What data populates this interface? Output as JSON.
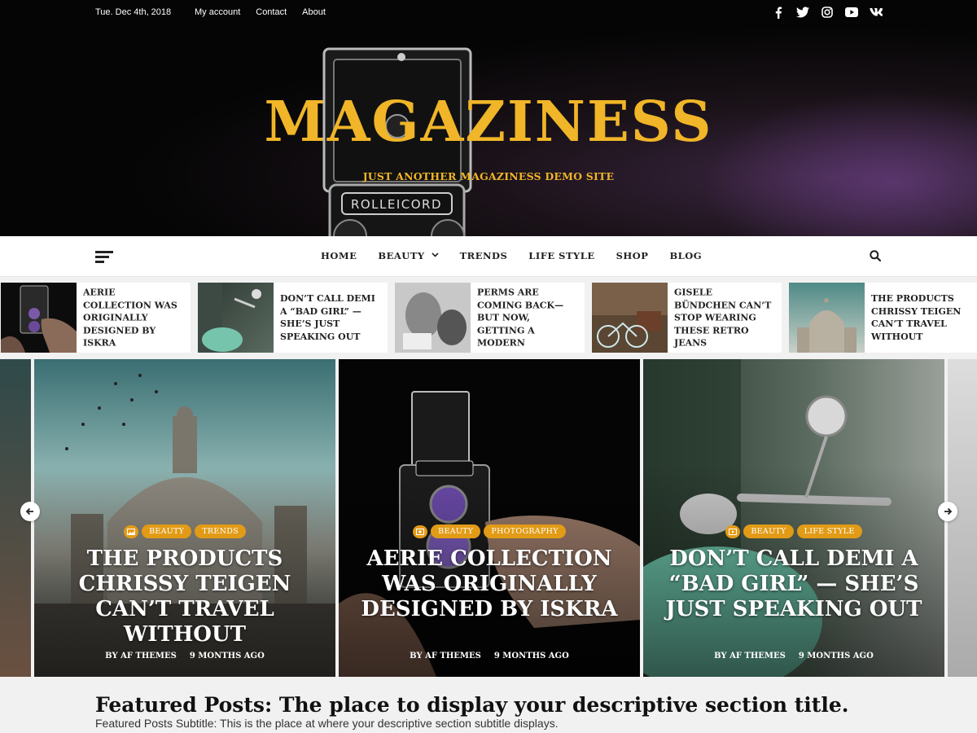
{
  "topbar": {
    "date": "Tue. Dec 4th, 2018",
    "links": [
      "My account",
      "Contact",
      "About"
    ],
    "socials": [
      "facebook-icon",
      "twitter-icon",
      "instagram-icon",
      "youtube-icon",
      "vk-icon"
    ]
  },
  "header": {
    "site_title": "MAGAZINESS",
    "tagline": "JUST ANOTHER MAGAZINESS DEMO SITE",
    "camera_label": "ROLLEICORD",
    "accent_color": "#f0b528"
  },
  "nav": {
    "items": [
      "HOME",
      "BEAUTY",
      "TRENDS",
      "LIFE STYLE",
      "SHOP",
      "BLOG"
    ]
  },
  "ticker": [
    {
      "title": "Aerie Collection was Originally Designed by Iskra"
    },
    {
      "title": "Don’t Call Demi a “Bad Girl” — She’s Just Speaking Out"
    },
    {
      "title": "Perms are Coming Back—But Now, Getting a Modern"
    },
    {
      "title": "Gisele Bündchen Can’t Stop Wearing These Retro Jeans"
    },
    {
      "title": "The Products Chrissy Teigen Can’t Travel Without"
    }
  ],
  "slides": [
    {
      "title": "The Products Chrissy Teigen Can’t Travel Without",
      "cats": [
        "BEAUTY",
        "TRENDS"
      ],
      "author": "BY AF THEMES",
      "time": "9 MONTHS AGO"
    },
    {
      "title": "Aerie Collection was Originally Designed by Iskra",
      "cats": [
        "BEAUTY",
        "PHOTOGRAPHY"
      ],
      "author": "BY AF THEMES",
      "time": "9 MONTHS AGO"
    },
    {
      "title": "Don’t Call Demi a “Bad Girl” — She’s Just Speaking Out",
      "cats": [
        "BEAUTY",
        "LIFE STYLE"
      ],
      "author": "BY AF THEMES",
      "time": "9 MONTHS AGO"
    }
  ],
  "featured": {
    "title": "Featured Posts: The place to display your descriptive section title.",
    "subtitle": "Featured Posts Subtitle: This is the place at where your descriptive section subtitle displays."
  },
  "colors": {
    "badge": "#e29b16"
  }
}
